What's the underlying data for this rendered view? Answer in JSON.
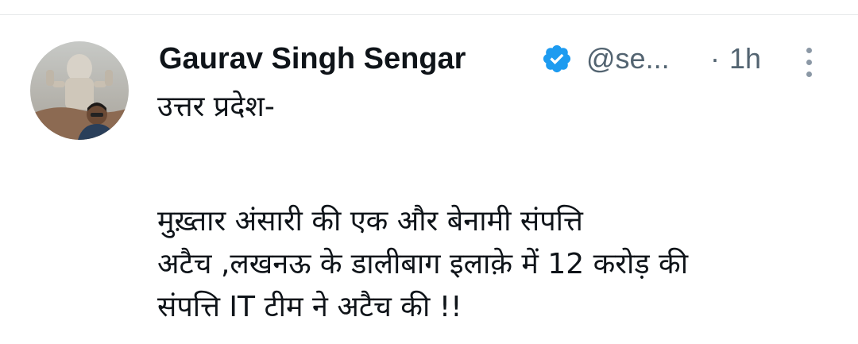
{
  "tweet": {
    "author": {
      "display_name": "Gaurav Singh Sengar",
      "handle": "@se...",
      "verified": true,
      "avatar_icon": "user-avatar-photo"
    },
    "separator": "·",
    "timestamp": "1h",
    "text_line_1": "उत्तर प्रदेश-",
    "text_paragraph": "मुख़्तार अंसारी की एक और बेनामी संपत्ति\nअटैच ,लखनऊ के डालीबाग इलाक़े में 12 करोड़ की\nसंपत्ति IT टीम ने अटैच की !!",
    "more_icon": "more-vertical-icon"
  },
  "colors": {
    "text_primary": "#0f1419",
    "text_secondary": "#536471",
    "verified_blue": "#1d9bf0",
    "divider": "#e7e9ea"
  }
}
